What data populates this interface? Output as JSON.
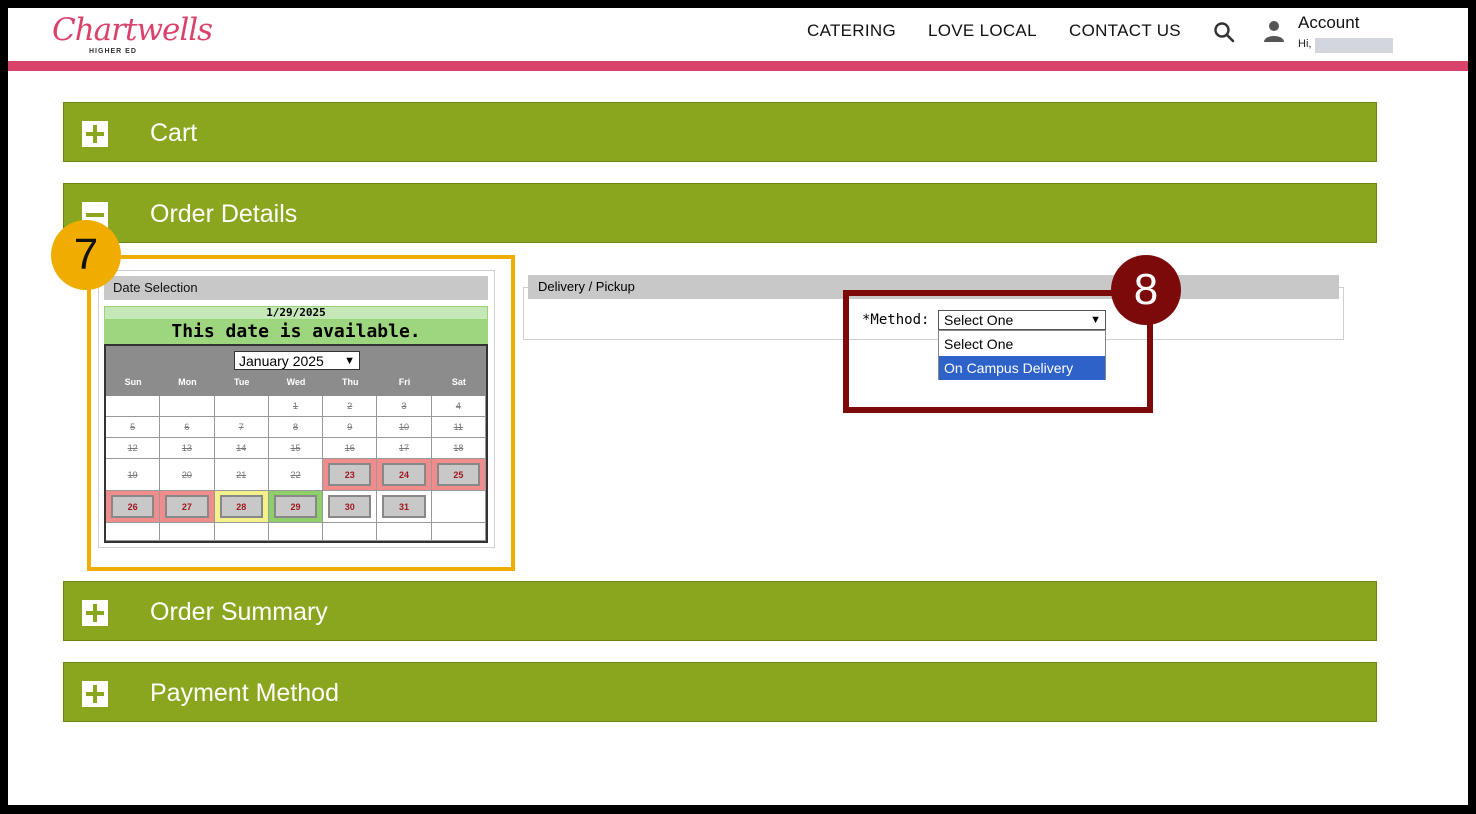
{
  "header": {
    "logo_text": "Chartwells",
    "logo_sub": "HIGHER ED",
    "nav": [
      "CATERING",
      "LOVE LOCAL",
      "CONTACT US"
    ],
    "account_title": "Account",
    "account_greeting": "Hi,",
    "brand_color": "#d9436b"
  },
  "accordion": {
    "cart": "Cart",
    "order_details": "Order Details",
    "order_summary": "Order Summary",
    "payment_method": "Payment Method",
    "color": "#8aa61f"
  },
  "date_selection": {
    "title": "Date Selection",
    "selected_date": "1/29/2025",
    "status": "This date is available.",
    "month": "January 2025",
    "weekdays": [
      "Sun",
      "Mon",
      "Tue",
      "Wed",
      "Thu",
      "Fri",
      "Sat"
    ],
    "weeks": [
      [
        null,
        null,
        null,
        {
          "d": "1",
          "s": "past"
        },
        {
          "d": "2",
          "s": "past"
        },
        {
          "d": "3",
          "s": "past"
        },
        {
          "d": "4",
          "s": "past"
        }
      ],
      [
        {
          "d": "5",
          "s": "past"
        },
        {
          "d": "6",
          "s": "past"
        },
        {
          "d": "7",
          "s": "past"
        },
        {
          "d": "8",
          "s": "past"
        },
        {
          "d": "9",
          "s": "past"
        },
        {
          "d": "10",
          "s": "past"
        },
        {
          "d": "11",
          "s": "past"
        }
      ],
      [
        {
          "d": "12",
          "s": "past"
        },
        {
          "d": "13",
          "s": "past"
        },
        {
          "d": "14",
          "s": "past"
        },
        {
          "d": "15",
          "s": "past"
        },
        {
          "d": "16",
          "s": "past"
        },
        {
          "d": "17",
          "s": "past"
        },
        {
          "d": "18",
          "s": "past"
        }
      ],
      [
        {
          "d": "19",
          "s": "past"
        },
        {
          "d": "20",
          "s": "past"
        },
        {
          "d": "21",
          "s": "past"
        },
        {
          "d": "22",
          "s": "past"
        },
        {
          "d": "23",
          "s": "red"
        },
        {
          "d": "24",
          "s": "red"
        },
        {
          "d": "25",
          "s": "red"
        }
      ],
      [
        {
          "d": "26",
          "s": "red"
        },
        {
          "d": "27",
          "s": "red"
        },
        {
          "d": "28",
          "s": "yellow"
        },
        {
          "d": "29",
          "s": "green"
        },
        {
          "d": "30",
          "s": "plain"
        },
        {
          "d": "31",
          "s": "plain"
        },
        null
      ],
      [
        null,
        null,
        null,
        null,
        null,
        null,
        null
      ]
    ],
    "state_colors": {
      "red": "#f08c8c",
      "yellow": "#f4f08a",
      "green": "#8fcf6a",
      "plain": "#ffffff"
    }
  },
  "delivery": {
    "title": "Delivery / Pickup",
    "method_label": "*Method:",
    "method_value": "Select One",
    "options": [
      "Select One",
      "On Campus Delivery"
    ],
    "highlighted_option": 1
  },
  "callouts": {
    "step7": "7",
    "step8": "8",
    "color7": "#f0ad00",
    "color8": "#7d0a0a"
  }
}
